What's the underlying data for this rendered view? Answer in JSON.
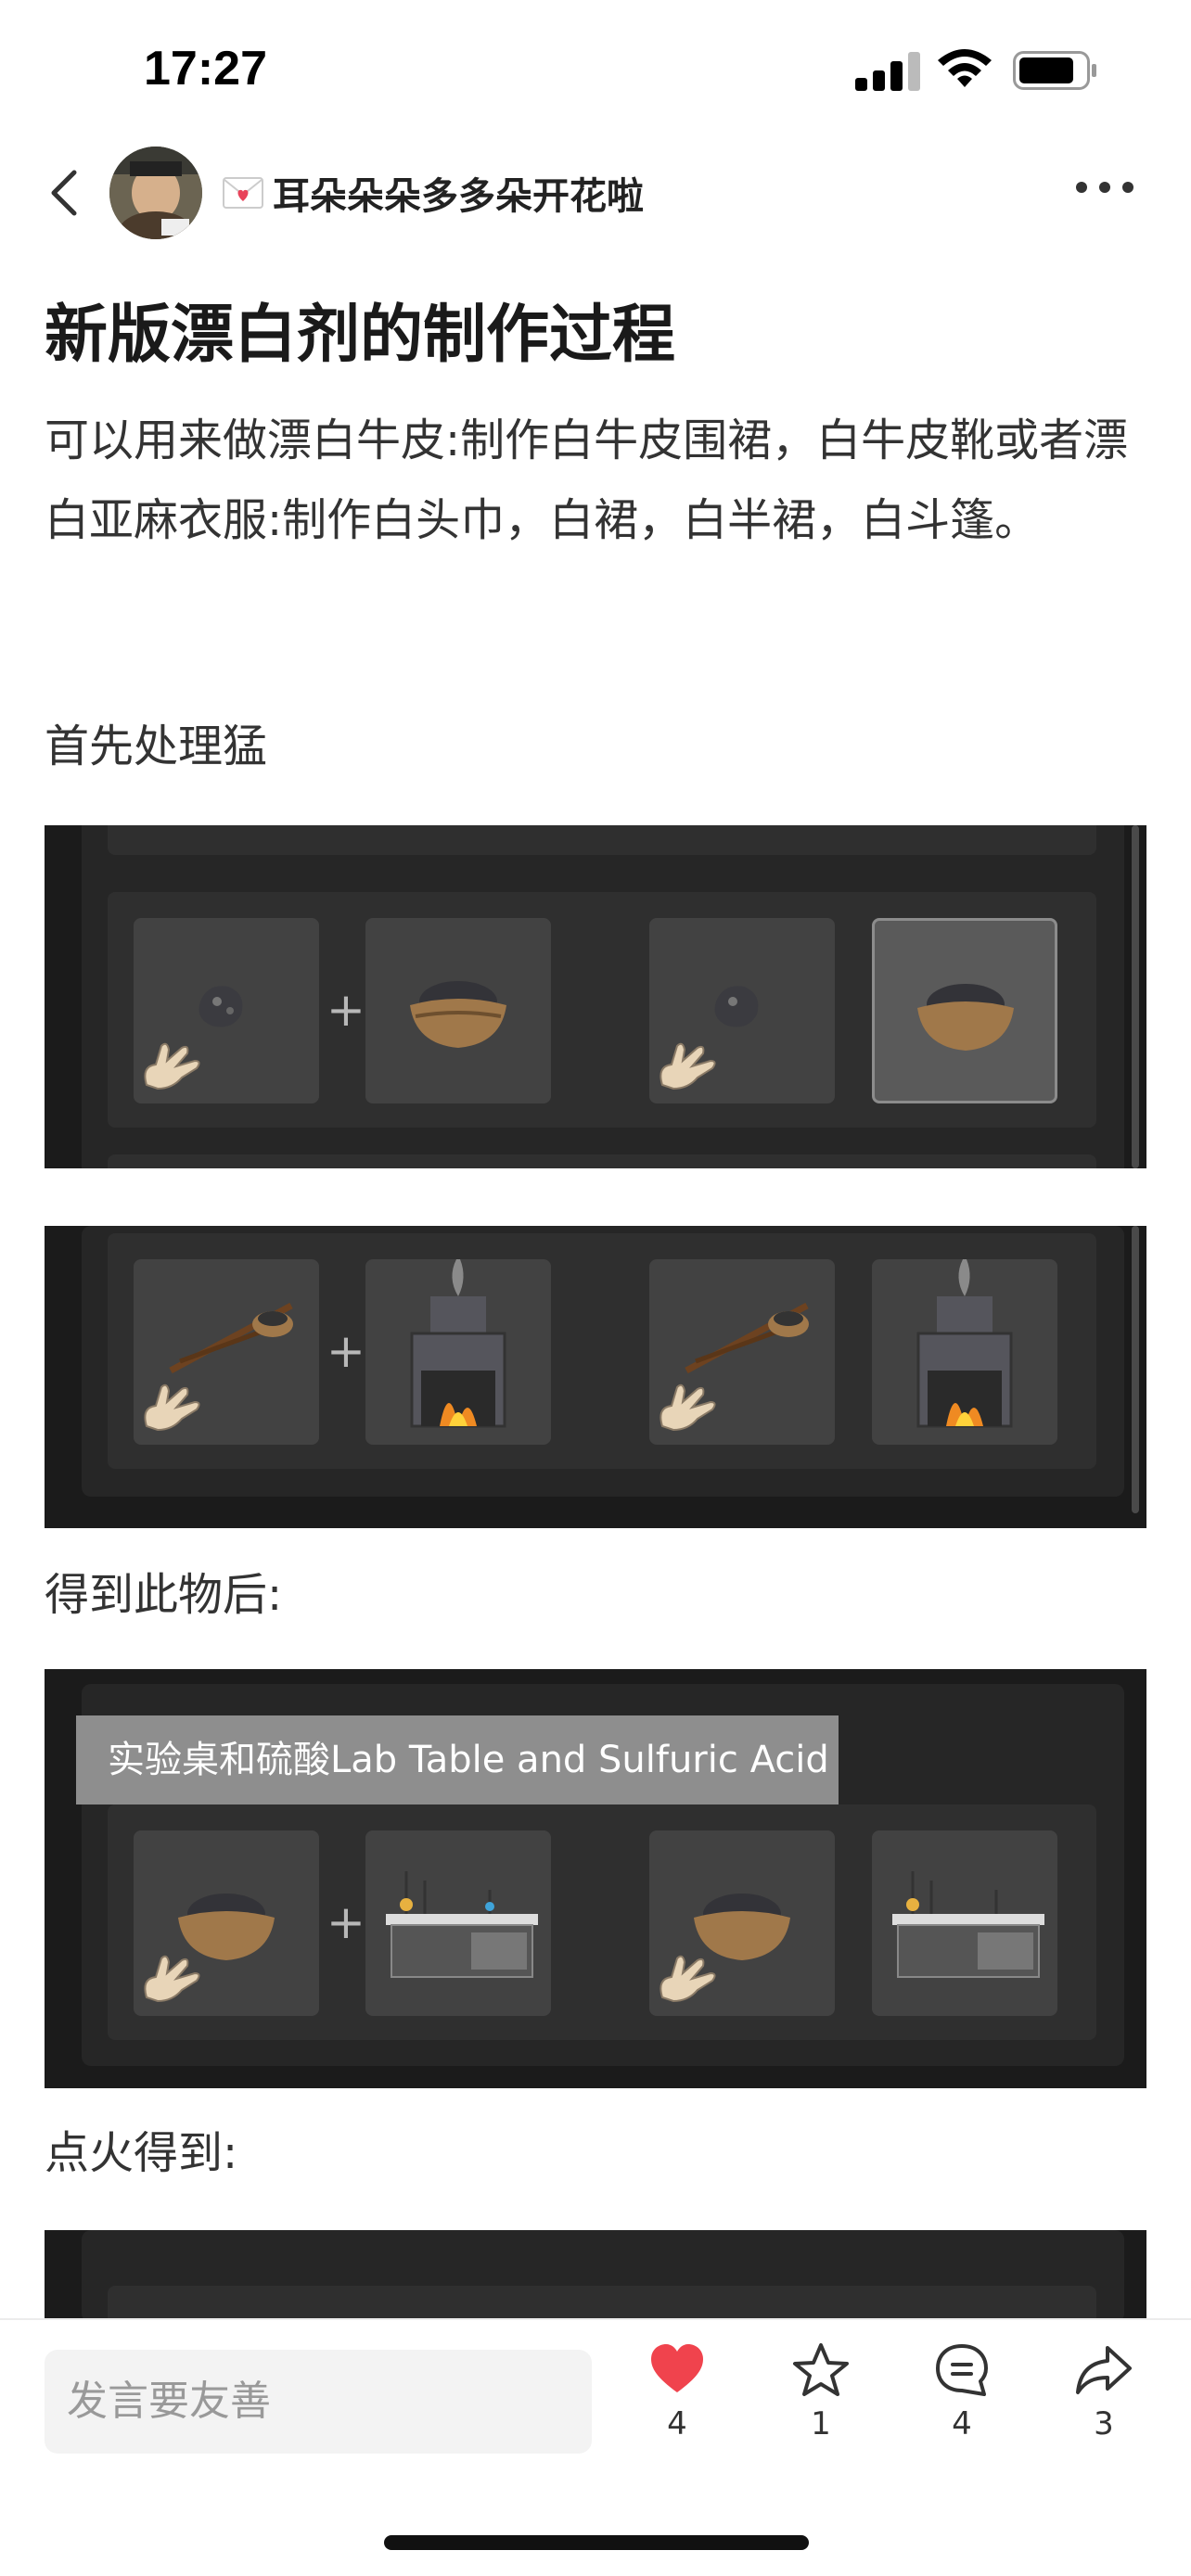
{
  "status": {
    "time": "17:27"
  },
  "header": {
    "username": "耳朵朵朵多多朵开花啦"
  },
  "post": {
    "title": "新版漂白剂的制作过程",
    "body": "可以用来做漂白牛皮:制作白牛皮围裙，白牛皮靴或者漂白亚麻衣服:制作白头巾，白裙，白半裙，白斗篷。",
    "section1": "首先处理猛",
    "section2": "得到此物后:",
    "section3": "点火得到:",
    "tooltip": "实验桌和硫酸Lab Table and Sulfuric Acid"
  },
  "bottom_bar": {
    "comment_placeholder": "发言要友善",
    "like_count": "4",
    "favorite_count": "1",
    "comment_count": "4",
    "share_count": "3"
  },
  "colors": {
    "like": "#f0434d",
    "game_bg": "#1b1b1b"
  },
  "icons": [
    "back-icon",
    "envelope-icon",
    "more-icon",
    "heart-icon",
    "star-icon",
    "comment-icon",
    "share-icon"
  ]
}
